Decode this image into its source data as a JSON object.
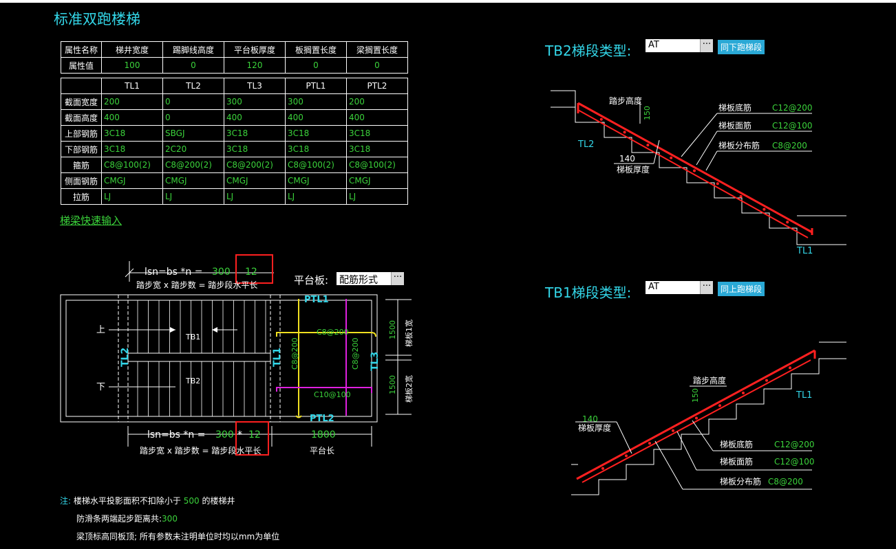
{
  "title": "标准双跑楼梯",
  "props": {
    "headers": [
      "属性名称",
      "梯井宽度",
      "踢脚线高度",
      "平台板厚度",
      "板搁置长度",
      "梁搁置长度"
    ],
    "row_label": "属性值",
    "values": [
      "100",
      "0",
      "120",
      "0",
      "0"
    ]
  },
  "beams": {
    "columns": [
      "",
      "TL1",
      "TL2",
      "TL3",
      "PTL1",
      "PTL2"
    ],
    "rows": [
      {
        "label": "截面宽度",
        "values": [
          "200",
          "0",
          "300",
          "300",
          "200"
        ]
      },
      {
        "label": "截面高度",
        "values": [
          "400",
          "0",
          "400",
          "400",
          "400"
        ]
      },
      {
        "label": "上部钢筋",
        "values": [
          "3C18",
          "SBGJ",
          "3C18",
          "3C18",
          "3C18"
        ]
      },
      {
        "label": "下部钢筋",
        "values": [
          "3C18",
          "2C20",
          "3C18",
          "3C18",
          "3C18"
        ]
      },
      {
        "label": "箍筋",
        "values": [
          "C8@100(2)",
          "C8@200(2)",
          "C8@200(2)",
          "C8@100(2)",
          "C8@100(2)"
        ]
      },
      {
        "label": "侧面钢筋",
        "values": [
          "CMGJ",
          "CMGJ",
          "CMGJ",
          "CMGJ",
          "CMGJ"
        ]
      },
      {
        "label": "拉筋",
        "values": [
          "LJ",
          "LJ",
          "LJ",
          "LJ",
          "LJ"
        ]
      }
    ]
  },
  "quick_input_link": "梯梁快速输入",
  "plan": {
    "top_formula_prefix": "lsn=bs *n = ",
    "top_bs": "300",
    "top_n": "12",
    "top_caption": "踏步宽 x 踏步数 = 踏步段水平长",
    "platform_label": "平台板:",
    "platform_combo": "配筋形式",
    "up": "上",
    "down": "下",
    "tb1": "TB1",
    "tb2": "TB2",
    "tl2": "TL2",
    "tl1": "TL1",
    "tl3": "TL3",
    "ptl1": "PTL1",
    "ptl2": "PTL2",
    "bar_top": "C8@200",
    "bar_bot": "C10@100",
    "bar_v1": "C8@200",
    "bar_v2": "C8@200",
    "dim_1500a": "1500",
    "dim_1500b": "1500",
    "w1_label": "梯板1宽",
    "w2_label": "梯板2宽",
    "bot_formula_prefix": "lsn=bs *n = ",
    "bot_bs": "300",
    "bot_star": "*",
    "bot_n": "12",
    "bot_caption": "踏步宽 x 踏步数 = 踏步段水平长",
    "plat_len": "1800",
    "plat_len_label": "平台长"
  },
  "notes": {
    "prefix": "注:",
    "line1_a": "楼梯水平投影面积不扣除小于",
    "line1_v": "500",
    "line1_b": "的楼梯井",
    "line2_a": "防滑条两端起步距离共:",
    "line2_v": "300",
    "line3": "梁顶标高同板顶; 所有参数未注明单位时均以mm为单位"
  },
  "tb2": {
    "label": "TB2梯段类型:",
    "combo": "AT",
    "button": "同下跑梯段",
    "step_h": "踏步高度",
    "dim150": "150",
    "bot_bar": "梯板底筋",
    "bot_bar_v": "C12@200",
    "top_bar": "梯板面筋",
    "top_bar_v": "C12@100",
    "dist_bar": "梯板分布筋",
    "dist_bar_v": "C8@200",
    "thk_v": "140",
    "thk": "梯板厚度",
    "tl2": "TL2",
    "tl1": "TL1"
  },
  "tb1": {
    "label": "TB1梯段类型:",
    "combo": "AT",
    "button": "同上跑梯段",
    "step_h": "踏步高度",
    "dim150": "150",
    "thk_v": "140",
    "thk": "梯板厚度",
    "bot_bar": "梯板底筋",
    "bot_bar_v": "C12@200",
    "top_bar": "梯板面筋",
    "top_bar_v": "C12@100",
    "dist_bar": "梯板分布筋",
    "dist_bar_v": "C8@200",
    "tl1": "TL1"
  },
  "colors": {
    "cyan": "#33d6e8",
    "green": "#3bd33b",
    "red": "#ff2020",
    "yellow": "#f0e020",
    "magenta": "#e020e0"
  }
}
